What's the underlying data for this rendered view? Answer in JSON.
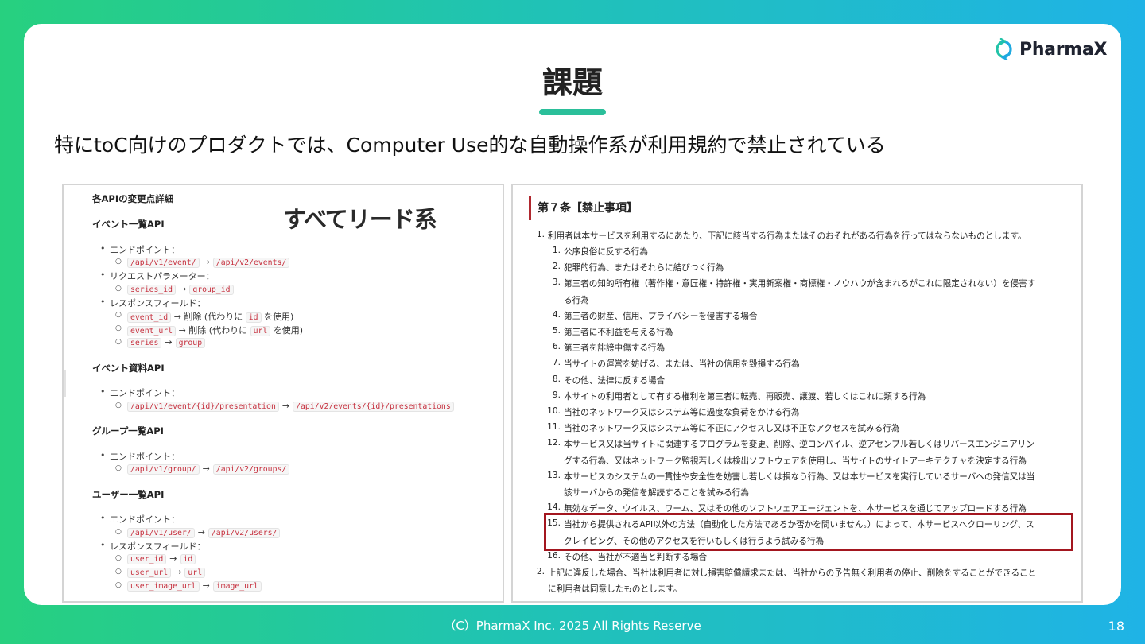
{
  "logo": {
    "text": "PharmaX"
  },
  "title": "課題",
  "subtitle": "特にtoC向けのプロダクトでは、Computer Use的な自動操作系が利用規約で禁止されている",
  "left_panel": {
    "heading": "各APIの変更点詳細",
    "annotation": "すべてリード系",
    "sections": [
      {
        "title": "イベント一覧API",
        "endpoint_label": "エンドポイント：",
        "endpoint_old": "/api/v1/event/",
        "endpoint_new": "/api/v2/events/",
        "param_label": "リクエストパラメーター：",
        "param_old": "series_id",
        "param_new": "group_id",
        "field_label": "レスポンスフィールド：",
        "f1_code": "event_id",
        "f1_text_a": "→ 削除 (代わりに",
        "f1_code2": "id",
        "f1_text_b": "を使用)",
        "f2_code": "event_url",
        "f2_text_a": "→ 削除 (代わりに",
        "f2_code2": "url",
        "f2_text_b": "を使用)",
        "f3_old": "series",
        "f3_new": "group"
      },
      {
        "title": "イベント資料API",
        "endpoint_label": "エンドポイント：",
        "endpoint_old": "/api/v1/event/{id}/presentation",
        "endpoint_new": "/api/v2/events/{id}/presentations"
      },
      {
        "title": "グループ一覧API",
        "endpoint_label": "エンドポイント：",
        "endpoint_old": "/api/v1/group/",
        "endpoint_new": "/api/v2/groups/"
      },
      {
        "title": "ユーザー一覧API",
        "endpoint_label": "エンドポイント：",
        "endpoint_old": "/api/v1/user/",
        "endpoint_new": "/api/v2/users/",
        "field_label": "レスポンスフィールド：",
        "f1_old": "user_id",
        "f1_new": "id",
        "f2_old": "user_url",
        "f2_new": "url",
        "f3_old": "user_image_url",
        "f3_new": "image_url"
      }
    ],
    "arrow": "→"
  },
  "right_panel": {
    "article_title": "第７条【禁止事項】",
    "item1_num": "1.",
    "item1_text": "利用者は本サービスを利用するにあたり、下記に該当する行為またはそのおそれがある行為を行ってはならないものとします。",
    "subitems": [
      {
        "num": "1.",
        "lines": [
          "公序良俗に反する行為"
        ]
      },
      {
        "num": "2.",
        "lines": [
          "犯罪的行為、またはそれらに結びつく行為"
        ]
      },
      {
        "num": "3.",
        "lines": [
          "第三者の知的所有権（著作権・意匠権・特許権・実用新案権・商標権・ノウハウが含まれるがこれに限定されない）を侵害す",
          "る行為"
        ]
      },
      {
        "num": "4.",
        "lines": [
          "第三者の財産、信用、プライバシーを侵害する場合"
        ]
      },
      {
        "num": "5.",
        "lines": [
          "第三者に不利益を与える行為"
        ]
      },
      {
        "num": "6.",
        "lines": [
          "第三者を誹謗中傷する行為"
        ]
      },
      {
        "num": "7.",
        "lines": [
          "当サイトの運営を妨げる、または、当社の信用を毀損する行為"
        ]
      },
      {
        "num": "8.",
        "lines": [
          "その他、法律に反する場合"
        ]
      },
      {
        "num": "9.",
        "lines": [
          "本サイトの利用者として有する権利を第三者に転売、再販売、譲渡、若しくはこれに類する行為"
        ]
      },
      {
        "num": "10.",
        "lines": [
          "当社のネットワーク又はシステム等に過度な負荷をかける行為"
        ]
      },
      {
        "num": "11.",
        "lines": [
          "当社のネットワーク又はシステム等に不正にアクセスし又は不正なアクセスを試みる行為"
        ]
      },
      {
        "num": "12.",
        "lines": [
          "本サービス又は当サイトに関連するプログラムを変更、削除、逆コンパイル、逆アセンブル若しくはリバースエンジニアリン",
          "グする行為、又はネットワーク監視若しくは検出ソフトウェアを使用し、当サイトのサイトアーキテクチャを決定する行為"
        ]
      },
      {
        "num": "13.",
        "lines": [
          "本サービスのシステムの一貫性や安全性を妨害し若しくは損なう行為、又は本サービスを実行しているサーバへの発信又は当",
          "該サーバからの発信を解読することを試みる行為"
        ]
      },
      {
        "num": "14.",
        "lines": [
          "無効なデータ、ウイルス、ワーム、又はその他のソフトウェアエージェントを、本サービスを通じてアップロードする行為"
        ]
      },
      {
        "num": "15.",
        "lines": [
          "当社から提供されるAPI以外の方法（自動化した方法であるか否かを問いません。）によって、本サービスへクローリング、ス",
          "クレイピング、その他のアクセスを行いもしくは行うよう試みる行為"
        ]
      },
      {
        "num": "16.",
        "lines": [
          "その他、当社が不適当と判断する場合"
        ]
      }
    ],
    "item2_num": "2.",
    "item2_lines": [
      "上記に違反した場合、当社は利用者に対し損害賠償請求または、当社からの予告無く利用者の停止、削除をすることができること",
      "に利用者は同意したものとします。"
    ]
  },
  "footer": "（C）PharmaX Inc. 2025  All Rights Reserve",
  "page_number": "18",
  "colors": {
    "accent": "#2bbf9a",
    "highlight_border": "#a3161f",
    "code_text": "#c6303e"
  }
}
